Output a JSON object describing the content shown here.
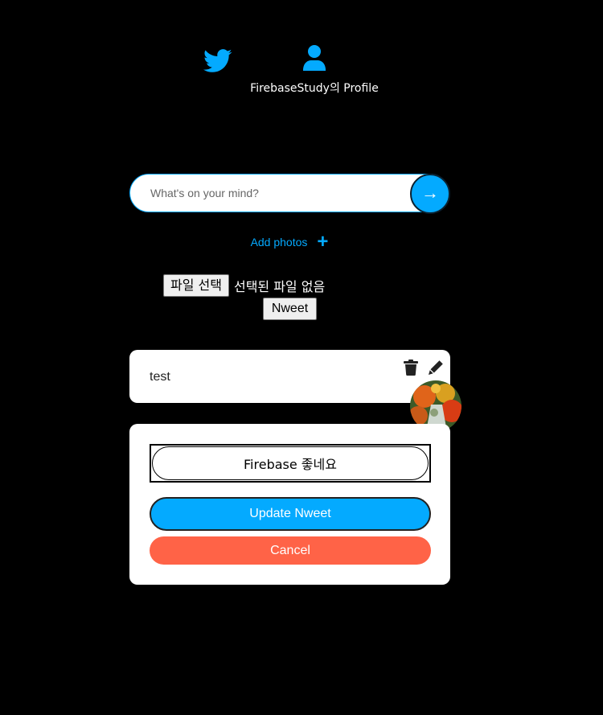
{
  "nav": {
    "home_icon": "twitter-bird-icon",
    "profile_icon": "user-icon",
    "profile_label": "FirebaseStudy의 Profile",
    "accent": "#04aaff"
  },
  "tweet_form": {
    "placeholder": "What's on your mind?",
    "value": "",
    "submit_icon": "arrow-right-icon",
    "submit_symbol": "→",
    "add_photos_label": "Add photos",
    "add_photos_icon": "plus-icon",
    "add_photos_symbol": "+",
    "file_button_label": "파일 선택",
    "file_status": "선택된 파일 없음",
    "nweet_button_label": "Nweet"
  },
  "nweets": [
    {
      "text": "test",
      "delete_icon": "trash-icon",
      "edit_icon": "pencil-icon",
      "image": "attached-photo-thumbnail"
    }
  ],
  "edit_form": {
    "value": "Firebase 좋네요",
    "update_label": "Update Nweet",
    "cancel_label": "Cancel",
    "update_color": "#04aaff",
    "cancel_color": "#ff6347"
  }
}
